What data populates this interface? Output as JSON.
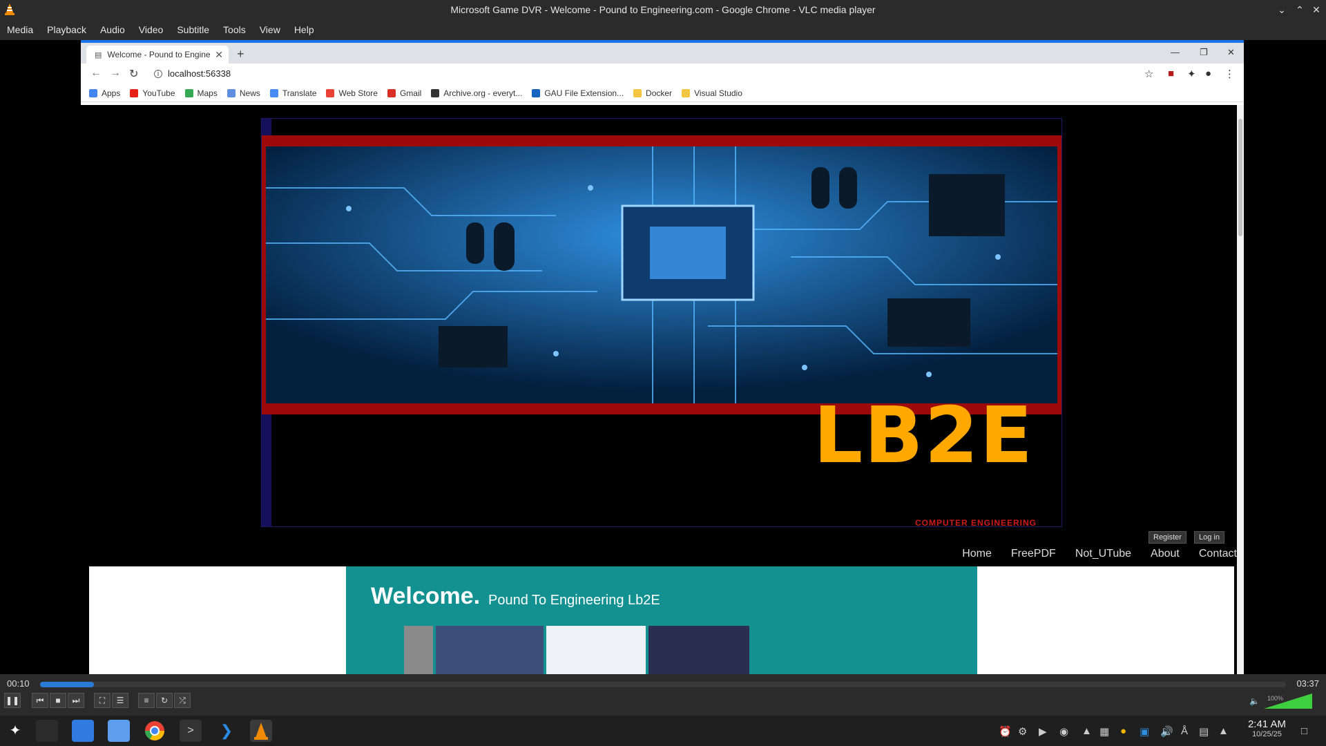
{
  "vlc": {
    "window_title": "Microsoft Game DVR - Welcome - Pound to Engineering.com - Google Chrome - VLC media player",
    "menu": [
      "Media",
      "Playback",
      "Audio",
      "Video",
      "Subtitle",
      "Tools",
      "View",
      "Help"
    ],
    "time_elapsed": "00:10",
    "time_total": "03:37",
    "progress_fraction": 0.043,
    "volume_label": "100%"
  },
  "chrome": {
    "tab_title": "Welcome - Pound to Engineering",
    "url": "localhost:56338",
    "bookmarks": [
      "Apps",
      "YouTube",
      "Maps",
      "News",
      "Translate",
      "Web Store",
      "Gmail",
      "Archive.org - everyt...",
      "GAU File Extension...",
      "Docker",
      "Visual Studio"
    ]
  },
  "site": {
    "logo_text": "LB2E",
    "subtitle": "COMPUTER ENGINEERING",
    "register": "Register",
    "login": "Log in",
    "nav": [
      "Home",
      "FreePDF",
      "Not_UTube",
      "About",
      "Contact"
    ],
    "welcome_heading": "Welcome.",
    "welcome_sub": "Pound To Engineering Lb2E"
  },
  "taskbar": {
    "time": "2:41 AM",
    "date": "10/25/25"
  }
}
